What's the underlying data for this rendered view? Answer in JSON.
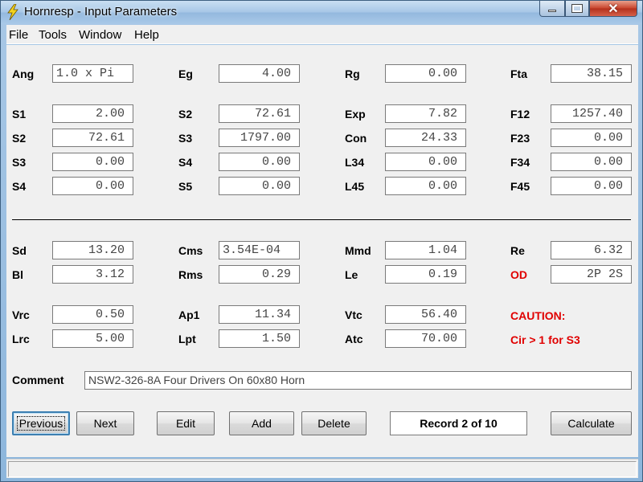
{
  "window": {
    "title": "Hornresp - Input Parameters"
  },
  "menu": [
    "File",
    "Tools",
    "Window",
    "Help"
  ],
  "fields": [
    {
      "label": "Ang",
      "value": "1.0 x Pi",
      "align": "left"
    },
    {
      "label": "Eg",
      "value": "4.00"
    },
    {
      "label": "Rg",
      "value": "0.00"
    },
    {
      "label": "Fta",
      "value": "38.15"
    },
    {
      "label": "S1",
      "value": "2.00"
    },
    {
      "label": "S2",
      "value": "72.61"
    },
    {
      "label": "Exp",
      "value": "7.82"
    },
    {
      "label": "F12",
      "value": "1257.40"
    },
    {
      "label": "S2",
      "value": "72.61"
    },
    {
      "label": "S3",
      "value": "1797.00"
    },
    {
      "label": "Con",
      "value": "24.33"
    },
    {
      "label": "F23",
      "value": "0.00"
    },
    {
      "label": "S3",
      "value": "0.00"
    },
    {
      "label": "S4",
      "value": "0.00"
    },
    {
      "label": "L34",
      "value": "0.00"
    },
    {
      "label": "F34",
      "value": "0.00"
    },
    {
      "label": "S4",
      "value": "0.00"
    },
    {
      "label": "S5",
      "value": "0.00"
    },
    {
      "label": "L45",
      "value": "0.00"
    },
    {
      "label": "F45",
      "value": "0.00"
    },
    {
      "label": "Sd",
      "value": "13.20"
    },
    {
      "label": "Cms",
      "value": "3.54E-04",
      "align": "left"
    },
    {
      "label": "Mmd",
      "value": "1.04"
    },
    {
      "label": "Re",
      "value": "6.32"
    },
    {
      "label": "Bl",
      "value": "3.12"
    },
    {
      "label": "Rms",
      "value": "0.29"
    },
    {
      "label": "Le",
      "value": "0.19"
    },
    {
      "label": "OD",
      "value": "2P 2S",
      "label_color": "red"
    },
    {
      "label": "Vrc",
      "value": "0.50"
    },
    {
      "label": "Ap1",
      "value": "11.34"
    },
    {
      "label": "Vtc",
      "value": "56.40"
    },
    {
      "label": "Lrc",
      "value": "5.00"
    },
    {
      "label": "Lpt",
      "value": "1.50"
    },
    {
      "label": "Atc",
      "value": "70.00"
    }
  ],
  "caution": {
    "title": "CAUTION:",
    "message": "Cir > 1 for S3"
  },
  "comment": {
    "label": "Comment",
    "value": "NSW2-326-8A Four Drivers On 60x80 Horn"
  },
  "buttons": {
    "previous": "Previous",
    "next": "Next",
    "edit": "Edit",
    "add": "Add",
    "delete": "Delete",
    "calculate": "Calculate"
  },
  "record": "Record 2 of 10",
  "status": "",
  "colors": {
    "warning": "#e00000",
    "titlebar": "#a6c6e6"
  }
}
